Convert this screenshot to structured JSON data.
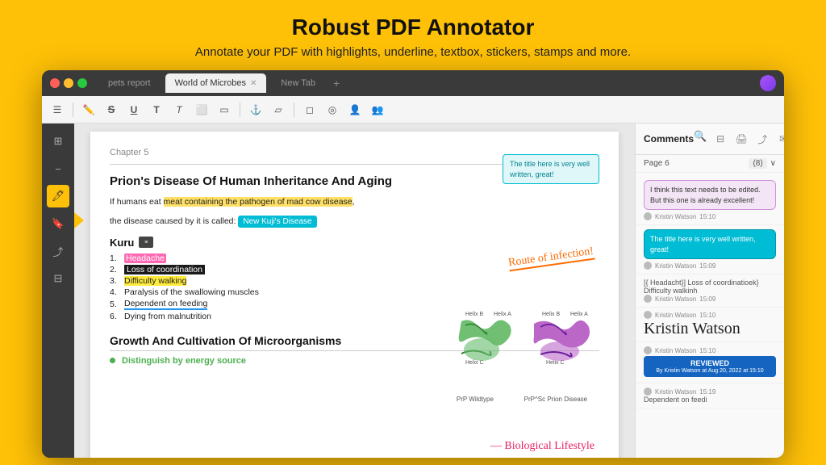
{
  "hero": {
    "title": "Robust PDF Annotator",
    "subtitle": "Annotate your PDF with highlights, underline, textbox, stickers, stamps and more."
  },
  "tabs": [
    {
      "label": "pets report",
      "active": false
    },
    {
      "label": "World of Microbes",
      "active": true
    },
    {
      "label": "New Tab",
      "active": false
    }
  ],
  "pdf": {
    "chapter": "Chapter 5",
    "title": "Prion's Disease Of Human Inheritance And Aging",
    "body1": "If humans eat meat containing the pathogen of mad cow disease,",
    "body2": "the disease caused by it is called: ",
    "new_kuji": "New Kuji's Disease",
    "route_annotation": "Route of infection!",
    "section_kuru": "Kuru",
    "list_items": [
      {
        "num": "1.",
        "text": "Headache",
        "style": "pink"
      },
      {
        "num": "2.",
        "text": "Loss of coordination",
        "style": "marker"
      },
      {
        "num": "3.",
        "text": "Difficulty walking",
        "style": "yellow"
      },
      {
        "num": "4.",
        "text": "Paralysis of the swallowing muscles",
        "style": "none"
      },
      {
        "num": "5.",
        "text": "Dependent on feeding",
        "style": "underline"
      },
      {
        "num": "6.",
        "text": "Dying from malnutrition",
        "style": "none"
      }
    ],
    "protein_labels": [
      "PrP Wildtype",
      "PrP^Sc Prion Disease"
    ],
    "growth_title": "Growth And Cultivation Of Microorganisms",
    "distinguish_text": "Distinguish by energy source",
    "biological_annotation": "— Biological Lifestyle",
    "textbox_annotation": "The title here is very well written, great!"
  },
  "comments": {
    "title": "Comments",
    "page_label": "Page 6",
    "count": "(8)",
    "items": [
      {
        "type": "bubble_purple",
        "text": "I think this text needs to be edited. But this one is already excellent!",
        "author": "Kristin Watson",
        "time": "15:10"
      },
      {
        "type": "bubble_teal",
        "text": "The title here is very well written, great!",
        "author": "Kristin Watson",
        "time": "15:09"
      },
      {
        "type": "text_only",
        "text": "[{ Headacht}] Loss of coordinatioek} Difficulty walkinh",
        "author": "Kristin Watson",
        "time": "15:09"
      },
      {
        "type": "signature",
        "text": "Kristin Watson",
        "author": "Kristin Watson",
        "time": "15:10"
      },
      {
        "type": "reviewed",
        "text": "REVIEWED",
        "sub": "By Kristin Watson at Aug 20, 2022 at 15:10",
        "author": "Kristin Watson",
        "time": "15:10"
      },
      {
        "type": "dep",
        "text": "Dependent on feedi",
        "author": "Kristin Watson",
        "time": "15:19"
      }
    ]
  }
}
